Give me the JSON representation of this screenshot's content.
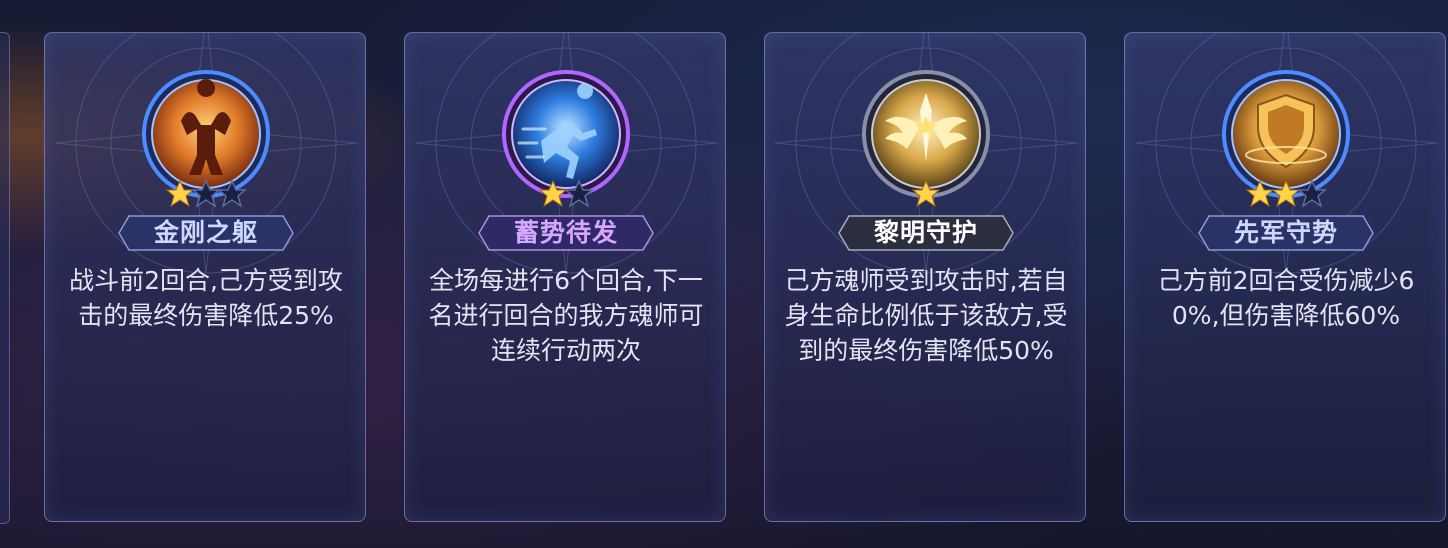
{
  "cards": [
    {
      "name": "金刚之躯",
      "stars_filled": 1,
      "stars_total": 3,
      "icon": "muscle-hero-icon",
      "description": "战斗前2回合,己方受到攻击的最终伤害降低25%",
      "colors": {
        "ring": "#4d8cff",
        "orb": "#e07a2a",
        "name": "#cfd7ff"
      }
    },
    {
      "name": "蓄势待发",
      "stars_filled": 1,
      "stars_total": 2,
      "icon": "sprinting-figure-icon",
      "description": "全场每进行6个回合,下一名进行回合的我方魂师可连续行动两次",
      "colors": {
        "ring": "#b266ff",
        "orb": "#2f7de0",
        "name": "#d8a6ff"
      }
    },
    {
      "name": "黎明守护",
      "stars_filled": 1,
      "stars_total": 1,
      "icon": "golden-wings-icon",
      "description": "己方魂师受到攻击时,若自身生命比例低于该敌方,受到的最终伤害降低50%",
      "colors": {
        "ring": "#8a8fa8",
        "orb": "#d8a84a",
        "name": "#ffffff"
      }
    },
    {
      "name": "先军守势",
      "stars_filled": 2,
      "stars_total": 3,
      "icon": "golden-shield-icon",
      "description": "己方前2回合受伤减少60%,但伤害降低60%",
      "colors": {
        "ring": "#4d8cff",
        "orb": "#d89a3a",
        "name": "#cfd7ff"
      }
    }
  ]
}
